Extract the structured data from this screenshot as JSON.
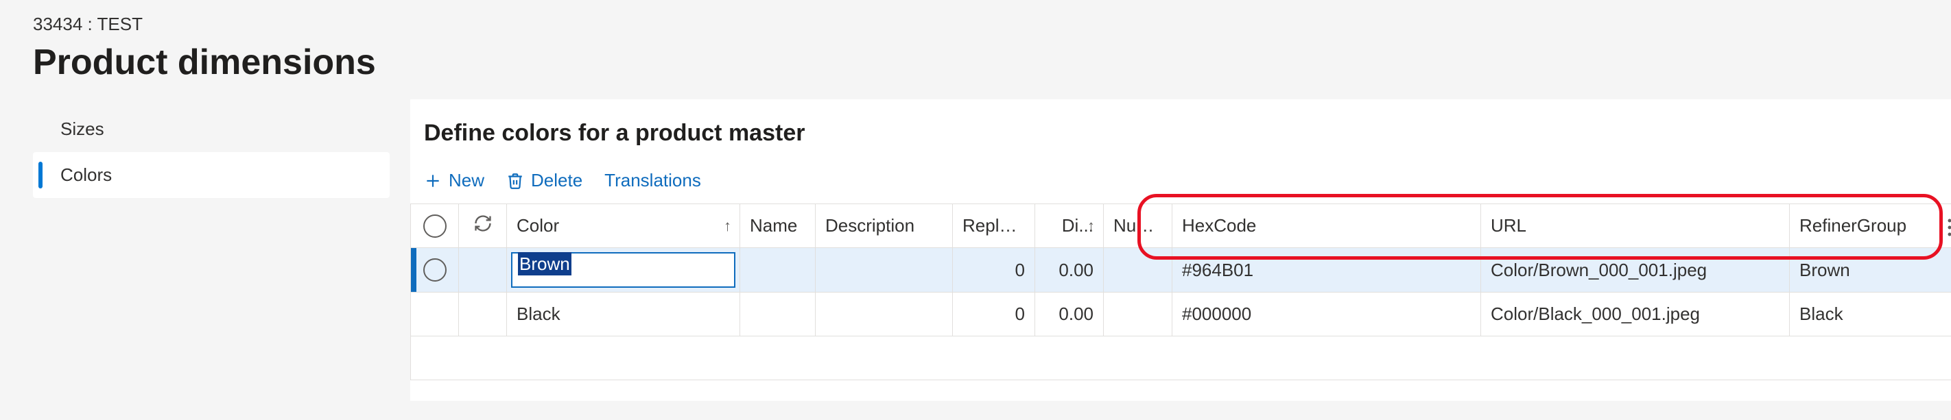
{
  "header": {
    "breadcrumb": "33434 : TEST",
    "title": "Product dimensions"
  },
  "sidebar": {
    "items": [
      {
        "label": "Sizes",
        "active": false
      },
      {
        "label": "Colors",
        "active": true
      }
    ]
  },
  "main": {
    "section_title": "Define colors for a product master",
    "toolbar": {
      "new_label": "New",
      "delete_label": "Delete",
      "translations_label": "Translations"
    },
    "columns": {
      "color": "Color",
      "name": "Name",
      "description": "Description",
      "replen": "Repleni...",
      "di": "Di...",
      "num": "Num...",
      "hex": "HexCode",
      "url": "URL",
      "refiner": "RefinerGroup"
    },
    "rows": [
      {
        "selected": true,
        "editing": true,
        "color": "Brown",
        "name": "",
        "description": "",
        "replen": "0",
        "di": "0.00",
        "num": "",
        "hex": "#964B01",
        "url": "Color/Brown_000_001.jpeg",
        "refiner": "Brown"
      },
      {
        "selected": false,
        "editing": false,
        "color": "Black",
        "name": "",
        "description": "",
        "replen": "0",
        "di": "0.00",
        "num": "",
        "hex": "#000000",
        "url": "Color/Black_000_001.jpeg",
        "refiner": "Black"
      }
    ]
  },
  "chart_data": {
    "type": "table",
    "title": "Define colors for a product master",
    "columns": [
      "Color",
      "Name",
      "Description",
      "Repleni...",
      "Di...",
      "Num...",
      "HexCode",
      "URL",
      "RefinerGroup"
    ],
    "rows": [
      [
        "Brown",
        "",
        "",
        "0",
        "0.00",
        "",
        "#964B01",
        "Color/Brown_000_001.jpeg",
        "Brown"
      ],
      [
        "Black",
        "",
        "",
        "0",
        "0.00",
        "",
        "#000000",
        "Color/Black_000_001.jpeg",
        "Black"
      ]
    ]
  }
}
